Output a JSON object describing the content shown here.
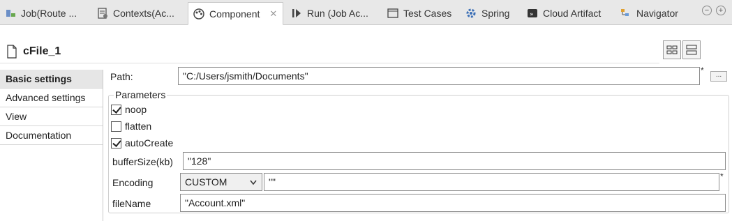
{
  "tabs": [
    {
      "label": "Job(Route ...",
      "icon": "job-icon"
    },
    {
      "label": "Contexts(Ac...",
      "icon": "contexts-icon"
    },
    {
      "label": "Component",
      "icon": "component-palette-icon",
      "active": true
    },
    {
      "label": "Run (Job Ac...",
      "icon": "run-icon"
    },
    {
      "label": "Test Cases",
      "icon": "test-cases-icon"
    },
    {
      "label": "Spring",
      "icon": "spring-gear-icon"
    },
    {
      "label": "Cloud Artifact",
      "icon": "cloud-artifact-icon"
    },
    {
      "label": "Navigator",
      "icon": "navigator-icon"
    }
  ],
  "window_controls": {
    "minimize": "−",
    "maximize": "+"
  },
  "component": {
    "title": "cFile_1",
    "icon": "document-icon"
  },
  "nav": [
    "Basic settings",
    "Advanced settings",
    "View",
    "Documentation"
  ],
  "form": {
    "path_label": "Path:",
    "path_value": "\"C:/Users/jsmith/Documents\"",
    "required_mark": "*",
    "browse_label": "...",
    "parameters_title": "Parameters",
    "noop_label": "noop",
    "noop_checked": true,
    "flatten_label": "flatten",
    "flatten_checked": false,
    "autocreate_label": "autoCreate",
    "autocreate_checked": true,
    "buffersize_label": "bufferSize(kb)",
    "buffersize_value": "\"128\"",
    "encoding_label": "Encoding",
    "encoding_selected": "CUSTOM",
    "encoding_custom_value": "\"\"",
    "filename_label": "fileName",
    "filename_value": "\"Account.xml\""
  },
  "colors": {
    "tab_bg": "#e8e8e8",
    "selected_nav_bg": "#e6e6e6",
    "border": "#8c8c8c"
  }
}
